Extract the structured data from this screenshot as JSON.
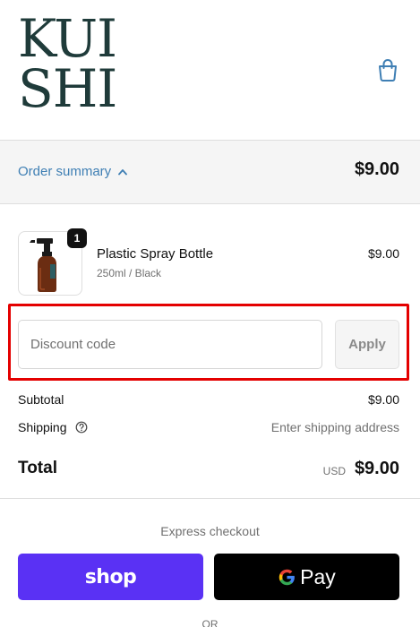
{
  "brand": {
    "logo_line1": "KUI",
    "logo_line2": "SHI"
  },
  "header": {
    "cart_icon": "shopping-bag-icon"
  },
  "order_summary": {
    "toggle_label": "Order summary",
    "toggle_icon": "chevron-up-icon",
    "total": "$9.00"
  },
  "product": {
    "quantity": "1",
    "name": "Plastic Spray Bottle",
    "variant": "250ml / Black",
    "price": "$9.00"
  },
  "discount": {
    "placeholder": "Discount code",
    "value": "",
    "apply_label": "Apply"
  },
  "totals": {
    "subtotal_label": "Subtotal",
    "subtotal_value": "$9.00",
    "shipping_label": "Shipping",
    "shipping_value": "Enter shipping address",
    "total_label": "Total",
    "currency": "USD",
    "total_value": "$9.00"
  },
  "express": {
    "label": "Express checkout",
    "shop_label": "shop",
    "gpay_label": "Pay",
    "or_label": "OR"
  },
  "colors": {
    "accent_link": "#3f7fb4",
    "brand_dark": "#1f3b3a",
    "shop_purple": "#5a31f4",
    "highlight_red": "#e40000"
  }
}
